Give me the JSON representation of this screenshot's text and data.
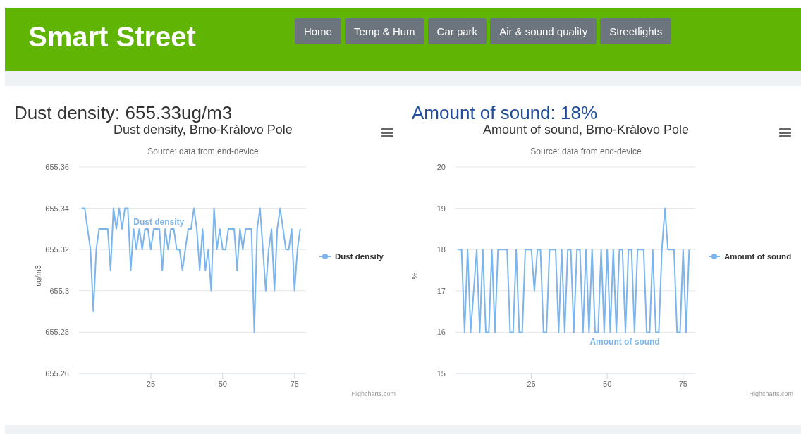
{
  "header": {
    "title": "Smart Street",
    "nav": [
      {
        "label": "Home"
      },
      {
        "label": "Temp & Hum"
      },
      {
        "label": "Car park"
      },
      {
        "label": "Air & sound quality"
      },
      {
        "label": "Streetlights"
      }
    ]
  },
  "panels": [
    {
      "heading": "Dust density: 655.33ug/m3",
      "color": "#333333",
      "credits": "Highcharts.com",
      "chart_data": {
        "type": "line",
        "title": "Dust density, Brno-Královo Pole",
        "subtitle": "Source: data from end-device",
        "ylabel": "ug/m3",
        "x": [
          1,
          2,
          3,
          4,
          5,
          6,
          7,
          8,
          9,
          10,
          11,
          12,
          13,
          14,
          15,
          16,
          17,
          18,
          19,
          20,
          21,
          22,
          23,
          24,
          25,
          26,
          27,
          28,
          29,
          30,
          31,
          32,
          33,
          34,
          35,
          36,
          37,
          38,
          39,
          40,
          41,
          42,
          43,
          44,
          45,
          46,
          47,
          48,
          49,
          50,
          51,
          52,
          53,
          54,
          55,
          56,
          57,
          58,
          59,
          60,
          61,
          62,
          63,
          64,
          65,
          66,
          67,
          68,
          69,
          70,
          71,
          72,
          73,
          74,
          75,
          76,
          77
        ],
        "series": [
          {
            "name": "Dust density",
            "color": "#7cb5ec",
            "values": [
              655.34,
              655.34,
              655.33,
              655.32,
              655.29,
              655.32,
              655.33,
              655.33,
              655.33,
              655.33,
              655.31,
              655.34,
              655.33,
              655.34,
              655.33,
              655.34,
              655.34,
              655.31,
              655.33,
              655.32,
              655.33,
              655.32,
              655.33,
              655.33,
              655.32,
              655.33,
              655.33,
              655.33,
              655.31,
              655.33,
              655.32,
              655.33,
              655.33,
              655.32,
              655.32,
              655.31,
              655.32,
              655.33,
              655.33,
              655.34,
              655.33,
              655.31,
              655.33,
              655.31,
              655.32,
              655.3,
              655.34,
              655.32,
              655.33,
              655.32,
              655.32,
              655.33,
              655.33,
              655.33,
              655.31,
              655.33,
              655.32,
              655.33,
              655.33,
              655.33,
              655.28,
              655.33,
              655.34,
              655.32,
              655.3,
              655.32,
              655.33,
              655.3,
              655.33,
              655.34,
              655.33,
              655.32,
              655.32,
              655.33,
              655.3,
              655.32,
              655.33
            ]
          }
        ],
        "xlim": [
          0,
          79
        ],
        "ylim": [
          655.26,
          655.36
        ],
        "xticks": [
          25,
          50,
          75
        ],
        "yticks": [
          {
            "value": 655.26,
            "label": "655.26"
          },
          {
            "value": 655.28,
            "label": "655.28"
          },
          {
            "value": 655.3,
            "label": "655.3"
          },
          {
            "value": 655.32,
            "label": "655.32"
          },
          {
            "value": 655.34,
            "label": "655.34"
          },
          {
            "value": 655.36,
            "label": "655.36"
          }
        ],
        "grid": true,
        "annotations": [
          "Dust density"
        ]
      }
    },
    {
      "heading": "Amount of sound: 18%",
      "color": "#1f4e9c",
      "credits": "Highcharts.com",
      "chart_data": {
        "type": "line",
        "title": "Amount of sound, Brno-Královo Pole",
        "subtitle": "Source: data from end-device",
        "ylabel": "%",
        "x": [
          1,
          2,
          3,
          4,
          5,
          6,
          7,
          8,
          9,
          10,
          11,
          12,
          13,
          14,
          15,
          16,
          17,
          18,
          19,
          20,
          21,
          22,
          23,
          24,
          25,
          26,
          27,
          28,
          29,
          30,
          31,
          32,
          33,
          34,
          35,
          36,
          37,
          38,
          39,
          40,
          41,
          42,
          43,
          44,
          45,
          46,
          47,
          48,
          49,
          50,
          51,
          52,
          53,
          54,
          55,
          56,
          57,
          58,
          59,
          60,
          61,
          62,
          63,
          64,
          65,
          66,
          67,
          68,
          69,
          70,
          71,
          72,
          73,
          74,
          75,
          76,
          77
        ],
        "series": [
          {
            "name": "Amount of sound",
            "color": "#7cb5ec",
            "values": [
              18,
              18,
              16,
              18,
              16,
              17,
              18,
              16,
              18,
              16,
              16,
              18,
              16,
              18,
              18,
              18,
              18,
              16,
              16,
              18,
              16,
              16,
              18,
              18,
              18,
              17,
              18,
              18,
              16,
              16,
              18,
              18,
              18,
              16,
              18,
              16,
              18,
              18,
              16,
              18,
              18,
              16,
              18,
              16,
              18,
              16,
              16,
              18,
              16,
              18,
              16,
              18,
              16,
              18,
              18,
              16,
              18,
              18,
              16,
              18,
              18,
              18,
              16,
              16,
              18,
              16,
              16,
              18,
              19,
              18,
              18,
              18,
              16,
              16,
              18,
              16,
              18
            ]
          }
        ],
        "xlim": [
          0,
          79
        ],
        "ylim": [
          15,
          20
        ],
        "xticks": [
          25,
          50,
          75
        ],
        "yticks": [
          15,
          16,
          17,
          18,
          19,
          20
        ],
        "grid": true,
        "annotations": [
          "Amount of sound"
        ]
      }
    }
  ]
}
